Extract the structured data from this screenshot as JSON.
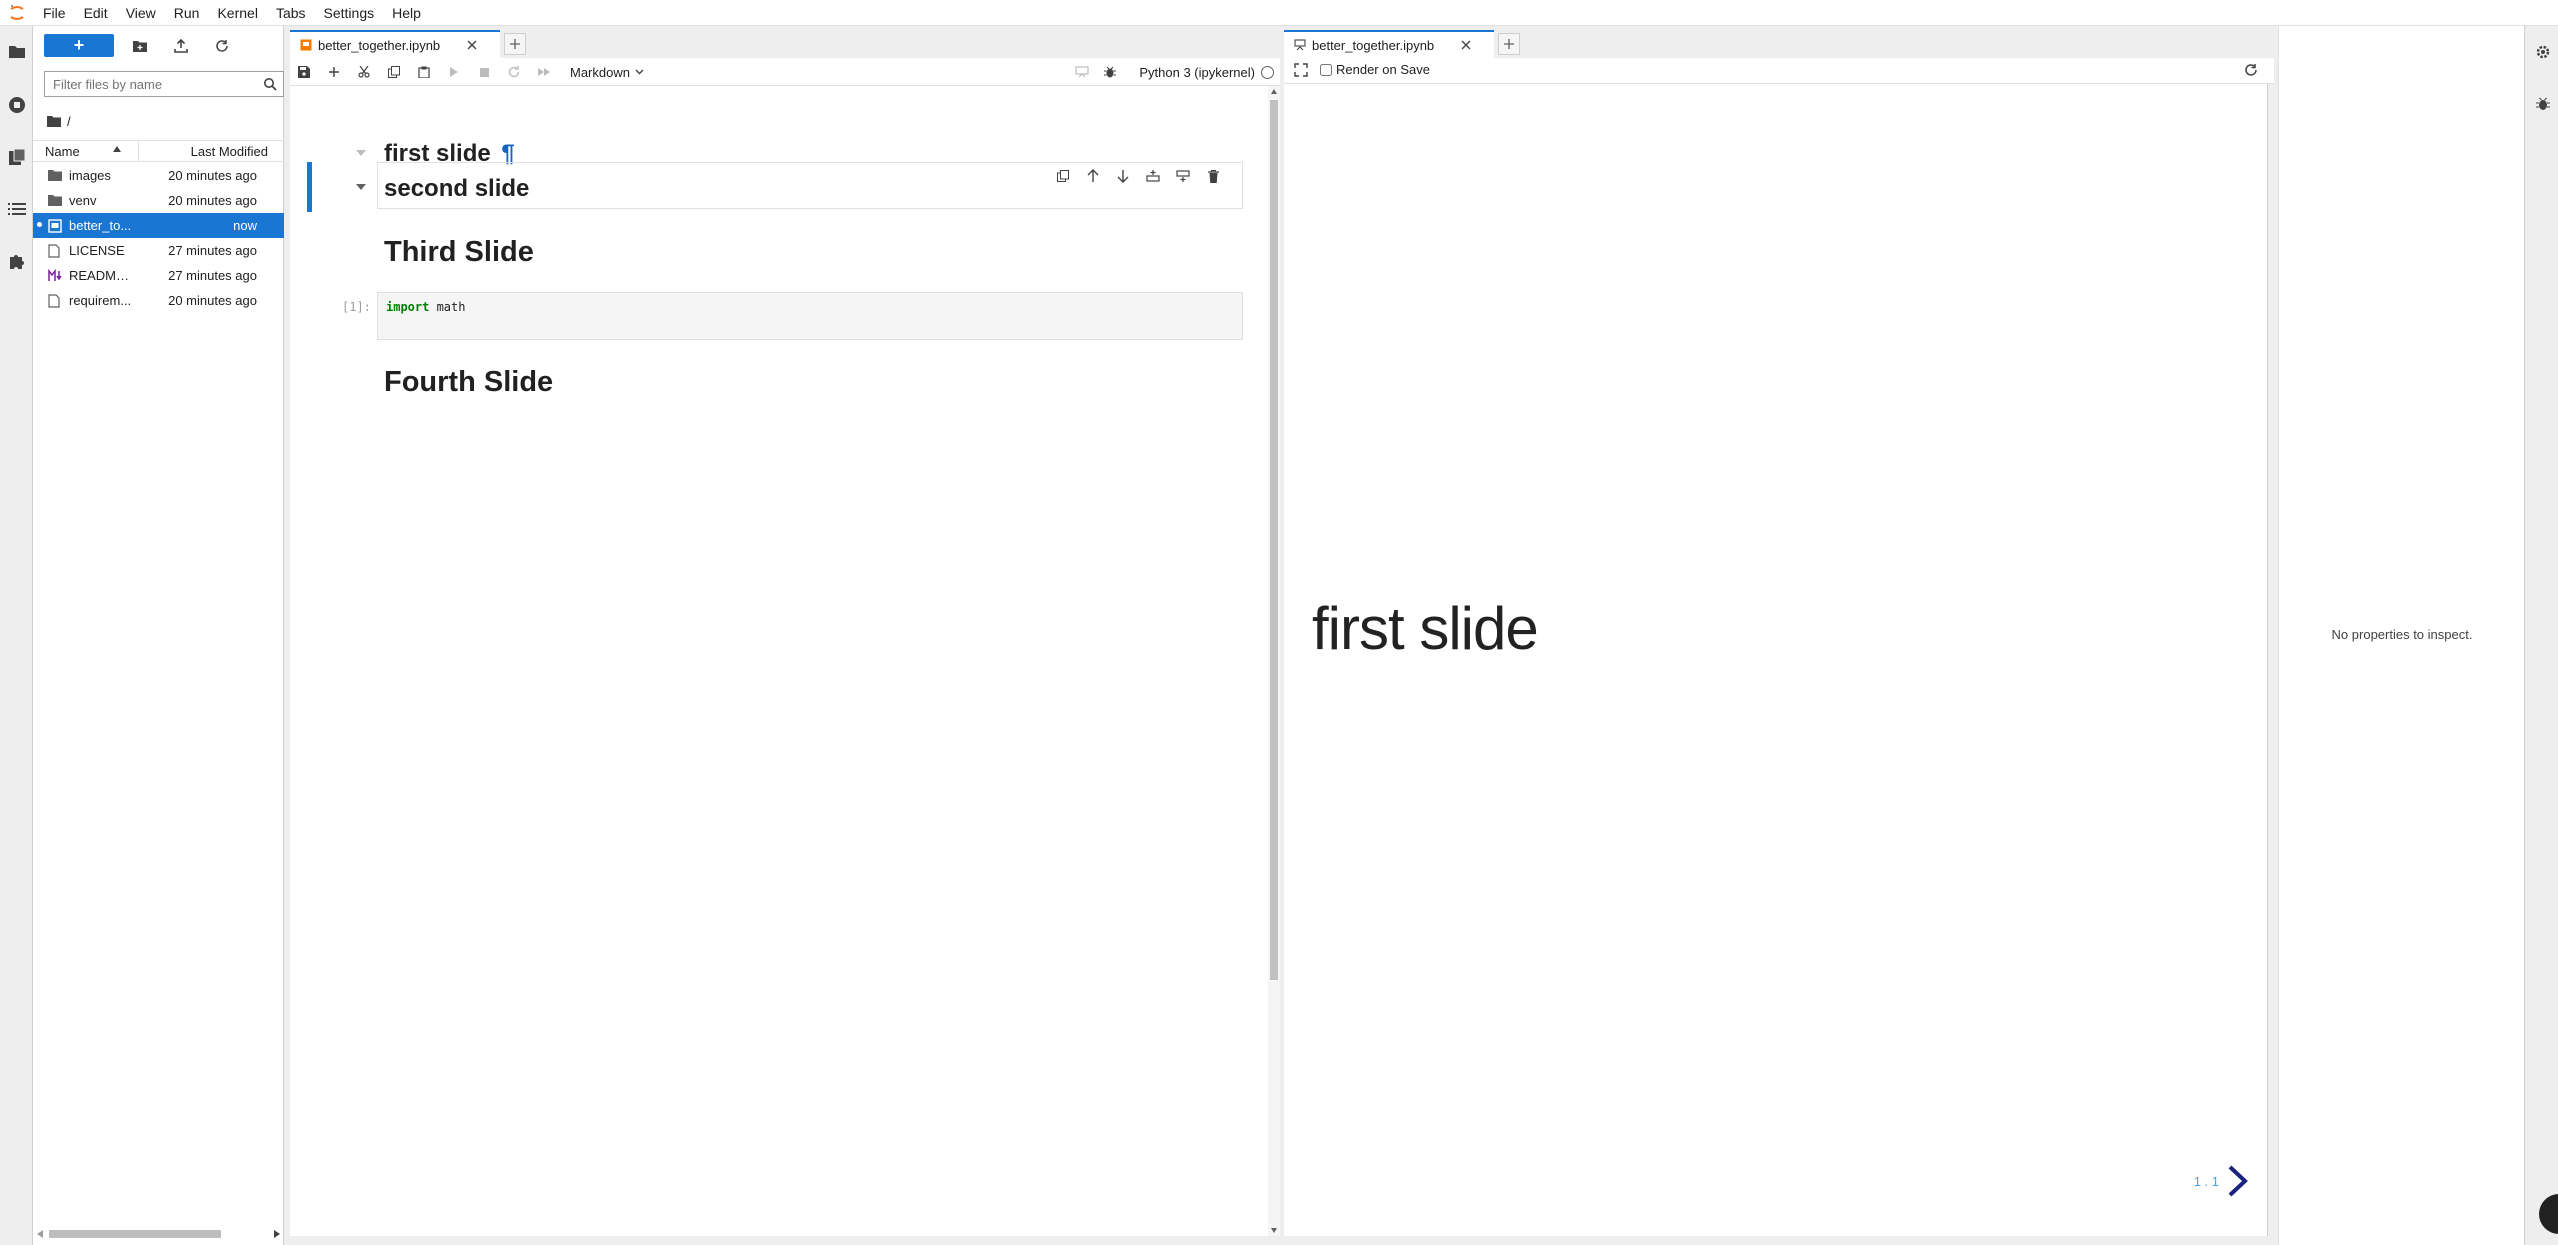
{
  "menu": [
    "File",
    "Edit",
    "View",
    "Run",
    "Kernel",
    "Tabs",
    "Settings",
    "Help"
  ],
  "filebrowser": {
    "new_label": "+",
    "filter_placeholder": "Filter files by name",
    "breadcrumb": "/",
    "col_name": "Name",
    "col_modified": "Last Modified",
    "files": [
      {
        "name": "images",
        "modified": "20 minutes ago",
        "icon": "folder-icon"
      },
      {
        "name": "venv",
        "modified": "20 minutes ago",
        "icon": "folder-icon"
      },
      {
        "name": "better_to...",
        "modified": "now",
        "icon": "notebook-icon",
        "selected": true
      },
      {
        "name": "LICENSE",
        "modified": "27 minutes ago",
        "icon": "file-icon"
      },
      {
        "name": "README....",
        "modified": "27 minutes ago",
        "icon": "markdown-icon"
      },
      {
        "name": "requirem...",
        "modified": "20 minutes ago",
        "icon": "file-icon"
      }
    ]
  },
  "notebook": {
    "tab_title": "better_together.ipynb",
    "cell_type": "Markdown",
    "kernel": "Python 3 (ipykernel)",
    "cells": {
      "first": "first slide",
      "pilcrow": "¶",
      "second": "second slide",
      "third": "Third Slide",
      "code_prompt": "[1]:",
      "code_keyword": "import",
      "code_rest": " math",
      "fourth": "Fourth Slide"
    }
  },
  "preview": {
    "tab_title": "better_together.ipynb",
    "render_on_save": "Render on Save",
    "slide_title": "first slide",
    "slide_number": "1 . 1"
  },
  "inspector": {
    "message": "No properties to inspect."
  },
  "colors": {
    "accent": "#1976d2",
    "code_keyword": "#008000"
  }
}
